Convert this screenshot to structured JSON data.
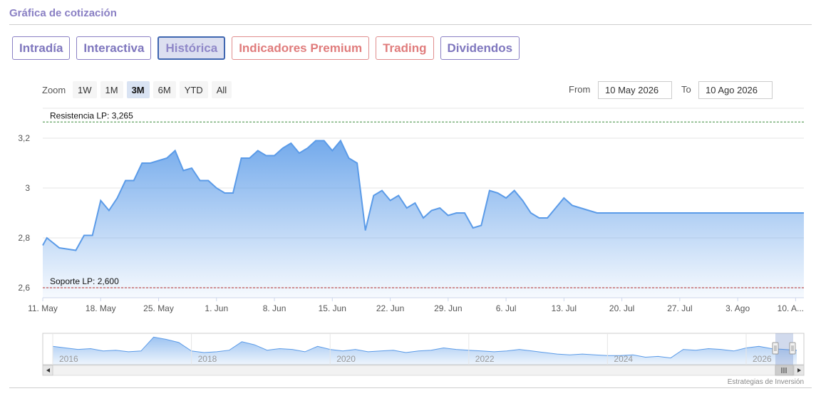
{
  "header": {
    "title": "Gráfica de cotización"
  },
  "tabs": [
    {
      "label": "Intradía",
      "style": "purple"
    },
    {
      "label": "Interactiva",
      "style": "purple"
    },
    {
      "label": "Histórica",
      "style": "active"
    },
    {
      "label": "Indicadores Premium",
      "style": "red"
    },
    {
      "label": "Trading",
      "style": "red"
    },
    {
      "label": "Dividendos",
      "style": "purple"
    }
  ],
  "range_selector": {
    "zoom_label": "Zoom",
    "buttons": [
      "1W",
      "1M",
      "3M",
      "6M",
      "YTD",
      "All"
    ],
    "selected": "3M",
    "from_label": "From",
    "from_value": "10 May 2026",
    "to_label": "To",
    "to_value": "10 Ago 2026"
  },
  "credits": "Estrategias de Inversión",
  "colors": {
    "series": "#5b9be8",
    "resistance": "#3a8a3a",
    "support": "#b02a2a",
    "title": "#8a80c4"
  },
  "chart_data": {
    "type": "area",
    "ylim": [
      2.56,
      3.32
    ],
    "y_ticks": [
      2.6,
      2.8,
      3.0,
      3.2
    ],
    "y_tick_labels": [
      "2,6",
      "2,8",
      "3",
      "3,2"
    ],
    "x_tick_labels": [
      "11. May",
      "18. May",
      "25. May",
      "1. Jun",
      "8. Jun",
      "15. Jun",
      "22. Jun",
      "29. Jun",
      "6. Jul",
      "13. Jul",
      "20. Jul",
      "27. Jul",
      "3. Ago",
      "10. A..."
    ],
    "plot_lines": [
      {
        "value": 3.265,
        "label": "Resistencia LP: 3,265",
        "color": "#3a8a3a"
      },
      {
        "value": 2.6,
        "label": "Soporte LP: 2,600",
        "color": "#b02a2a"
      }
    ],
    "x_day_range": [
      0,
      92
    ],
    "series": [
      {
        "x": [
          0,
          0.5,
          2,
          3,
          4,
          5,
          6,
          7,
          8,
          9,
          10,
          11,
          12,
          13,
          14,
          15,
          16,
          17,
          18,
          19,
          20,
          21,
          22,
          23,
          24,
          25,
          26,
          27,
          28,
          29,
          30,
          31,
          32,
          33,
          34,
          35,
          36,
          37,
          38,
          39,
          40,
          41,
          42,
          43,
          44,
          45,
          46,
          47,
          48,
          49,
          50,
          51,
          52,
          53,
          54,
          55,
          56,
          57,
          58,
          59,
          60,
          61,
          62,
          63,
          64,
          65,
          66,
          67,
          68,
          69,
          70,
          71,
          72,
          73,
          74,
          75,
          76,
          77,
          78,
          79,
          80,
          81,
          82,
          83,
          84,
          85,
          86,
          87,
          88,
          89,
          90,
          91,
          92
        ],
        "y": [
          2.77,
          2.8,
          2.76,
          2.755,
          2.75,
          2.81,
          2.81,
          2.95,
          2.91,
          2.96,
          3.03,
          3.03,
          3.1,
          3.1,
          3.11,
          3.12,
          3.15,
          3.07,
          3.08,
          3.03,
          3.03,
          3.0,
          2.98,
          2.98,
          3.12,
          3.12,
          3.15,
          3.13,
          3.13,
          3.16,
          3.18,
          3.14,
          3.16,
          3.19,
          3.19,
          3.15,
          3.19,
          3.12,
          3.1,
          2.83,
          2.97,
          2.99,
          2.95,
          2.97,
          2.92,
          2.94,
          2.88,
          2.91,
          2.92,
          2.89,
          2.9,
          2.9,
          2.84,
          2.85,
          2.99,
          2.98,
          2.96,
          2.99,
          2.95,
          2.9,
          2.88,
          2.88,
          2.92,
          2.96,
          2.93,
          2.92,
          2.91,
          2.9,
          2.9,
          2.9,
          2.9,
          2.9,
          2.9,
          2.9,
          2.9,
          2.9,
          2.9,
          2.9,
          2.9,
          2.9,
          2.9,
          2.9,
          2.9,
          2.9,
          2.9,
          2.9,
          2.9,
          2.9,
          2.9,
          2.9,
          2.9,
          2.9,
          2.9
        ]
      }
    ],
    "navigator": {
      "x_tick_labels": [
        "2016",
        "2018",
        "2020",
        "2022",
        "2024",
        "2026"
      ],
      "values": [
        2.9,
        2.88,
        2.86,
        2.87,
        2.84,
        2.85,
        2.83,
        2.84,
        3.02,
        2.99,
        2.95,
        2.84,
        2.82,
        2.83,
        2.85,
        2.96,
        2.92,
        2.85,
        2.87,
        2.86,
        2.83,
        2.9,
        2.86,
        2.84,
        2.86,
        2.83,
        2.84,
        2.85,
        2.82,
        2.84,
        2.85,
        2.88,
        2.86,
        2.85,
        2.84,
        2.83,
        2.84,
        2.86,
        2.84,
        2.82,
        2.8,
        2.79,
        2.8,
        2.79,
        2.78,
        2.78,
        2.79,
        2.76,
        2.77,
        2.75,
        2.86,
        2.85,
        2.87,
        2.86,
        2.84,
        2.88,
        2.9,
        2.87,
        2.86,
        2.85
      ]
    }
  }
}
